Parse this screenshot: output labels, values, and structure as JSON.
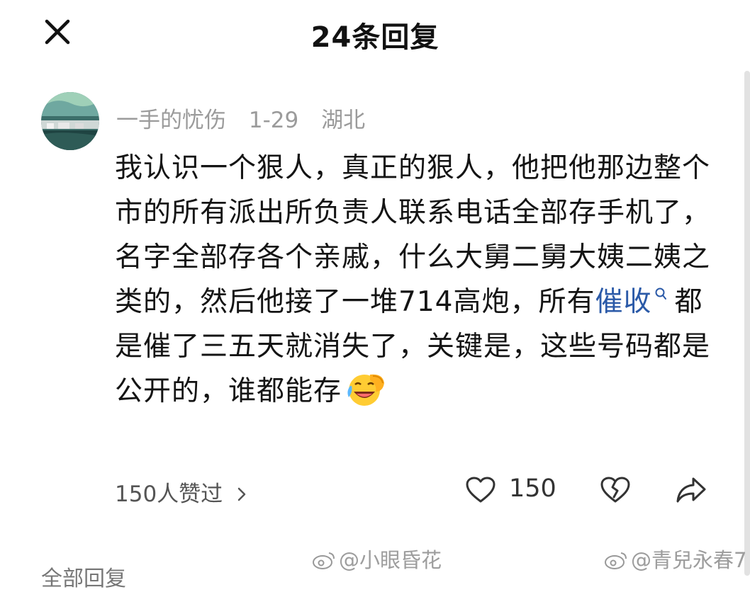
{
  "header": {
    "title": "24条回复"
  },
  "comment": {
    "author": "一手的忧伤",
    "date": "1-29",
    "location": "湖北",
    "text_before_link": "我认识一个狠人，真正的狠人，他把他那边整个市的所有派出所负责人联系电话全部存手机了，名字全部存各个亲戚，什么大舅二舅大姨二姨之类的，然后他接了一堆714高炮，所有",
    "link_text": "催收",
    "text_after_link": "都是催了三五天就消失了，关键是，这些号码都是公开的，谁都能存",
    "emoji": "laughing-crying-emoji",
    "likers_summary": "150人赞过",
    "like_count": "150"
  },
  "section": {
    "label": "全部回复"
  },
  "watermarks": [
    "@小眼昏花",
    "@青兒永春7"
  ],
  "icons": {
    "close": "close-icon",
    "like": "heart-icon",
    "dislike": "broken-heart-icon",
    "share": "share-arrow-icon",
    "search": "search-icon",
    "chevron": "chevron-right-icon",
    "weibo": "weibo-icon"
  },
  "colors": {
    "link": "#2b5aa8",
    "meta": "#9b9b9b",
    "text": "#141414"
  }
}
